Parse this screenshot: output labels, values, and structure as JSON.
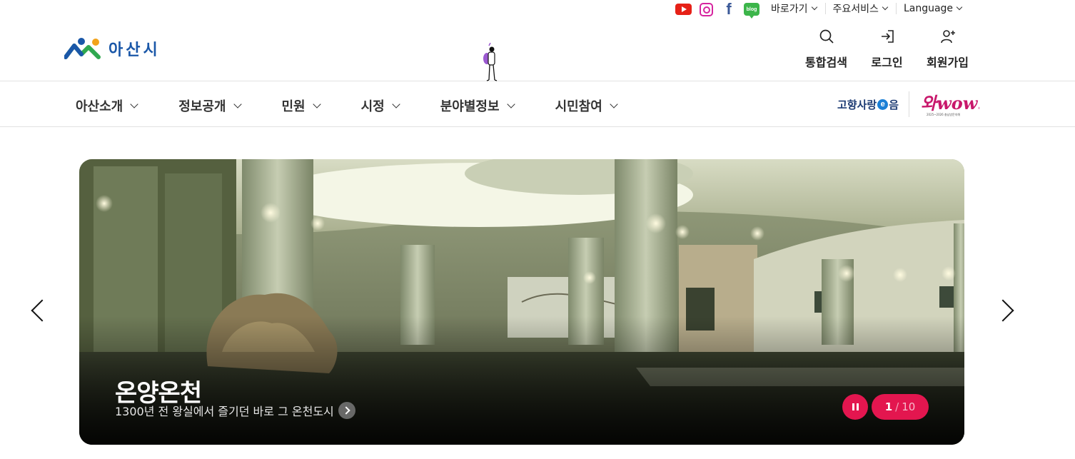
{
  "social": {
    "icons": [
      "youtube-icon",
      "instagram-icon",
      "facebook-icon",
      "blog-icon"
    ],
    "blog_label": "blog",
    "facebook_glyph": "f"
  },
  "utility_links": {
    "shortcut": "바로가기",
    "services": "주요서비스",
    "language": "Language"
  },
  "logo": {
    "text": "아산시"
  },
  "header_actions": {
    "search": "통합검색",
    "login": "로그인",
    "signup": "회원가입"
  },
  "nav": {
    "items": [
      "아산소개",
      "정보공개",
      "민원",
      "시정",
      "분야별정보",
      "시민참여"
    ]
  },
  "banners": {
    "gohyang_prefix": "고향사랑",
    "gohyang_e": "e",
    "gohyang_suffix": "음",
    "wow_text": "와wow!",
    "wow_sub": "2025~2026 충남방문의해"
  },
  "hero": {
    "title": "온양온천",
    "subtitle": "1300년 전 왕실에서 즐기던 바로 그 온천도시",
    "current": "1",
    "separator": "/",
    "total": "10"
  },
  "colors": {
    "accent": "#e3164f",
    "logo_blue": "#1a57a8",
    "gohyang_navy": "#1d3b73"
  }
}
